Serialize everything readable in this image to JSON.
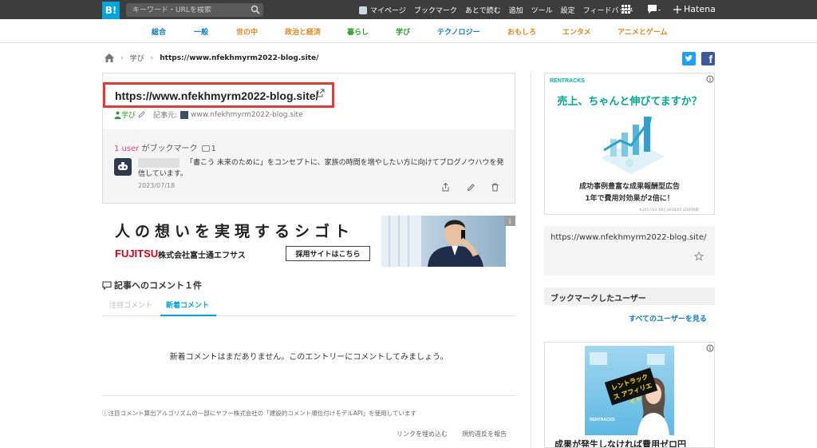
{
  "topbar": {
    "logo": "B!",
    "search_placeholder": "キーワード・URLを検索",
    "nav": [
      "マイページ",
      "ブックマーク",
      "あとで読む",
      "追加",
      "ツール",
      "設定",
      "フィードバック"
    ],
    "brand": "Hatena"
  },
  "categories": [
    {
      "label": "総合",
      "color": "#0a7cbf"
    },
    {
      "label": "一般",
      "color": "#0a7cbf"
    },
    {
      "label": "世の中",
      "color": "#e0891a"
    },
    {
      "label": "政治と経済",
      "color": "#e0891a"
    },
    {
      "label": "暮らし",
      "color": "#2b9a2d"
    },
    {
      "label": "学び",
      "color": "#2b9a2d"
    },
    {
      "label": "テクノロジー",
      "color": "#0a7cbf"
    },
    {
      "label": "おもしろ",
      "color": "#e0891a"
    },
    {
      "label": "エンタメ",
      "color": "#e0891a"
    },
    {
      "label": "アニメとゲーム",
      "color": "#e0891a"
    }
  ],
  "breadcrumb": {
    "category": "学び",
    "current": "https://www.nfekhmyrm2022-blog.site/"
  },
  "entry": {
    "title": "https://www.nfekhmyrm2022-blog.site/",
    "category": "学び",
    "source_label": "記事元:",
    "source": "www.nfekhmyrm2022-blog.site",
    "user_count": "1 user",
    "user_suffix": "がブックマーク",
    "comment_count": "1",
    "comment": "「書こう 未来のために」をコンセプトに、家族の時間を増やしたい方に向けてブログノウハウを発信しています。",
    "date": "2023/07/18"
  },
  "ad1": {
    "copy": "人の想いを実現するシゴト",
    "brand": "FUJITSU",
    "company": "株式会社富士通エフサス",
    "button": "採用サイトはこちら",
    "info": "i"
  },
  "comments": {
    "heading": "記事へのコメント１件",
    "tab_popular": "注目コメント",
    "tab_new": "新着コメント",
    "empty": "新着コメントはまだありません。このエントリーにコメントしてみましょう。",
    "note": "ⓘ注目コメント算出アルゴリズムの一部にヤフー株式会社の「建設的コメント順位付けモデルAPI」を使用しています",
    "embed_link": "リンクを埋め込む",
    "report_link": "規約違反を報告"
  },
  "sidebar": {
    "ad2": {
      "brand": "RENTRACKS",
      "headline": "売上、ちゃんと伸びてますか？",
      "sub1": "成功事例豊富な成果報酬型広告",
      "sub2": "1年で費用対効果が2倍に！",
      "fine": "※2017/03 2Qと2018/03 2Qの比較"
    },
    "url": "https://www.nfekhmyrm2022-blog.site/",
    "users_heading": "ブックマークしたユーザー",
    "all_users": "すべてのユーザーを見る",
    "ad3": {
      "badge": "レントラックス アフィリエイト",
      "brand": "RENTRACKS",
      "headline": "成果が発生しなければ費用ゼロ円"
    }
  }
}
